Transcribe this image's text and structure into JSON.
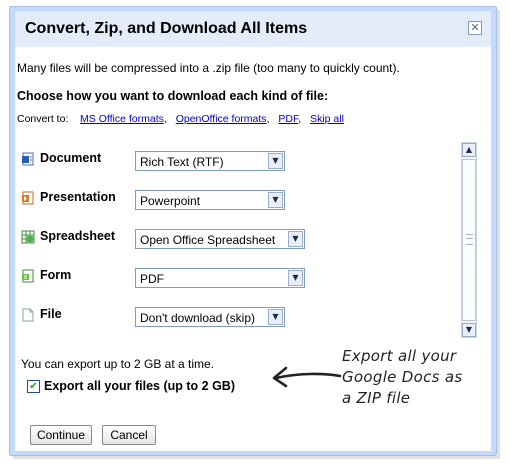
{
  "dialog": {
    "title": "Convert, Zip, and Download All Items",
    "close_symbol": "✕",
    "info": "Many files will be compressed into a .zip file (too many to quickly count).",
    "choose_heading": "Choose how you want to download each kind of file:",
    "convert_to_label": "Convert to:",
    "convert_links": [
      "MS Office formats",
      "OpenOffice formats",
      "PDF",
      "Skip all"
    ],
    "rows": [
      {
        "label": "Document",
        "selected": "Rich Text (RTF)",
        "icon": "document-icon"
      },
      {
        "label": "Presentation",
        "selected": "Powerpoint",
        "icon": "presentation-icon"
      },
      {
        "label": "Spreadsheet",
        "selected": "Open Office Spreadsheet",
        "icon": "spreadsheet-icon"
      },
      {
        "label": "Form",
        "selected": "PDF",
        "icon": "form-icon"
      },
      {
        "label": "File",
        "selected": "Don't download (skip)",
        "icon": "file-icon"
      }
    ],
    "limit_text": "You can export up to 2 GB at a time.",
    "export_all_label": "Export all your files (up to 2 GB)",
    "export_all_checked": true,
    "continue_label": "Continue",
    "cancel_label": "Cancel"
  },
  "annotation": {
    "line1": "Export all your",
    "line2": "Google Docs as",
    "line3": "a ZIP file"
  },
  "colors": {
    "dialog_frame": "#c3d9ff",
    "titlebar": "#e5ecf9",
    "link": "#0000cc"
  }
}
